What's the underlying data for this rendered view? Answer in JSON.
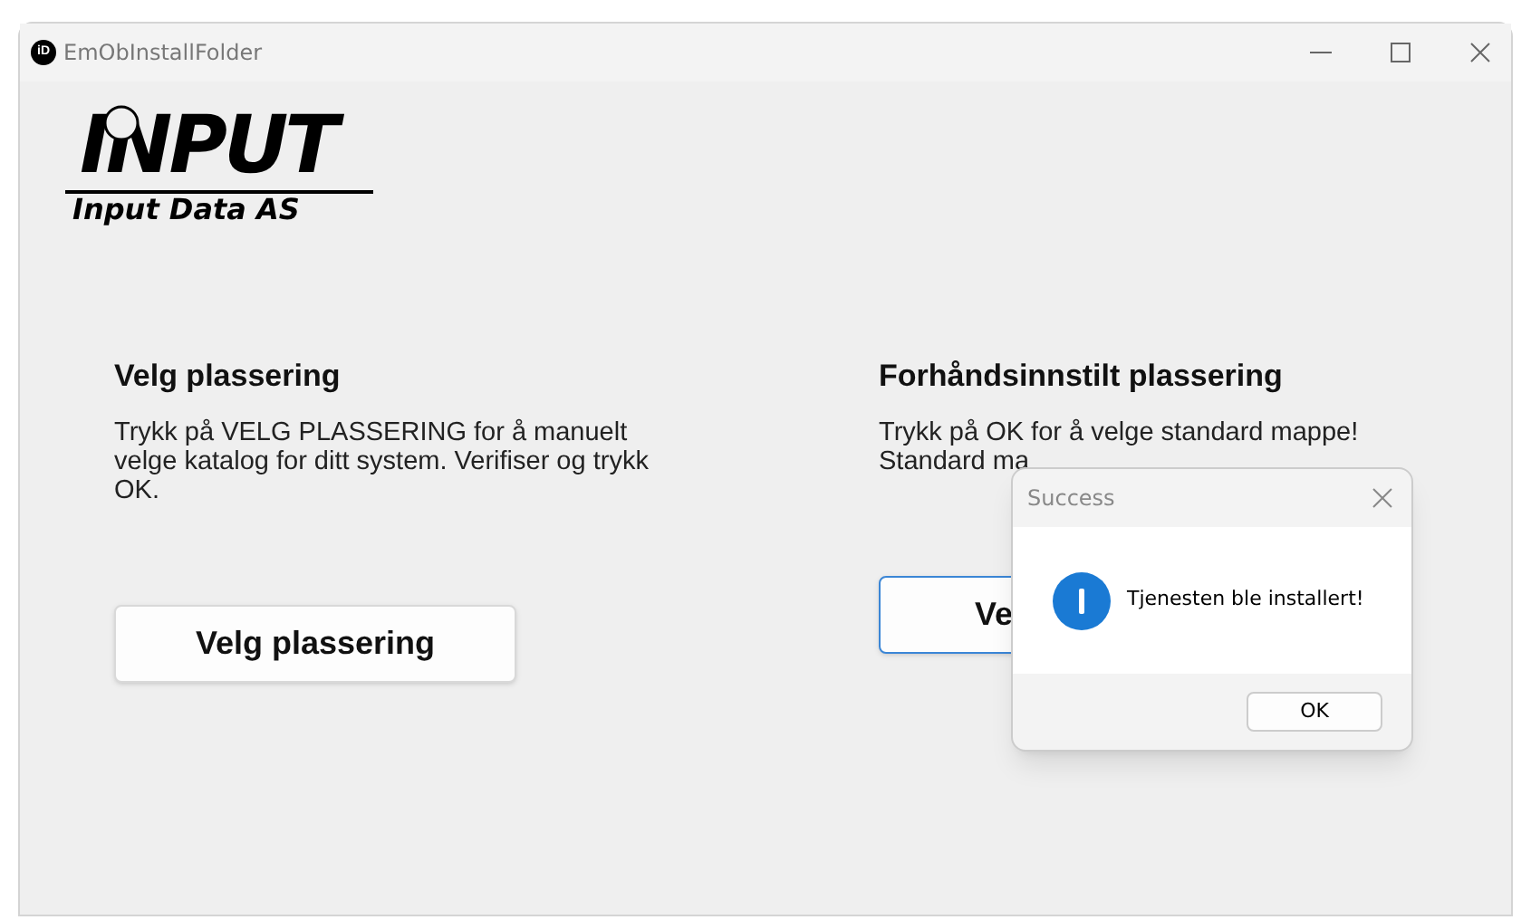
{
  "window": {
    "title": "EmObInstallFolder",
    "app_icon": "iD"
  },
  "logo": {
    "mark": "INPUT",
    "caption": "Input Data AS"
  },
  "sections": [
    {
      "heading": "Velg plassering",
      "text": "Trykk på VELG PLASSERING for å manuelt velge katalog for ditt system. Verifiser og trykk OK.",
      "button": "Velg plassering",
      "focused": false
    },
    {
      "heading": "Forhåndsinnstilt plassering",
      "text": "Trykk på OK for å velge standard mappe! Standard ma",
      "button": "Ve",
      "focused": true
    }
  ],
  "dialog": {
    "title": "Success",
    "message": "Tjenesten ble installert!",
    "button": "OK"
  }
}
